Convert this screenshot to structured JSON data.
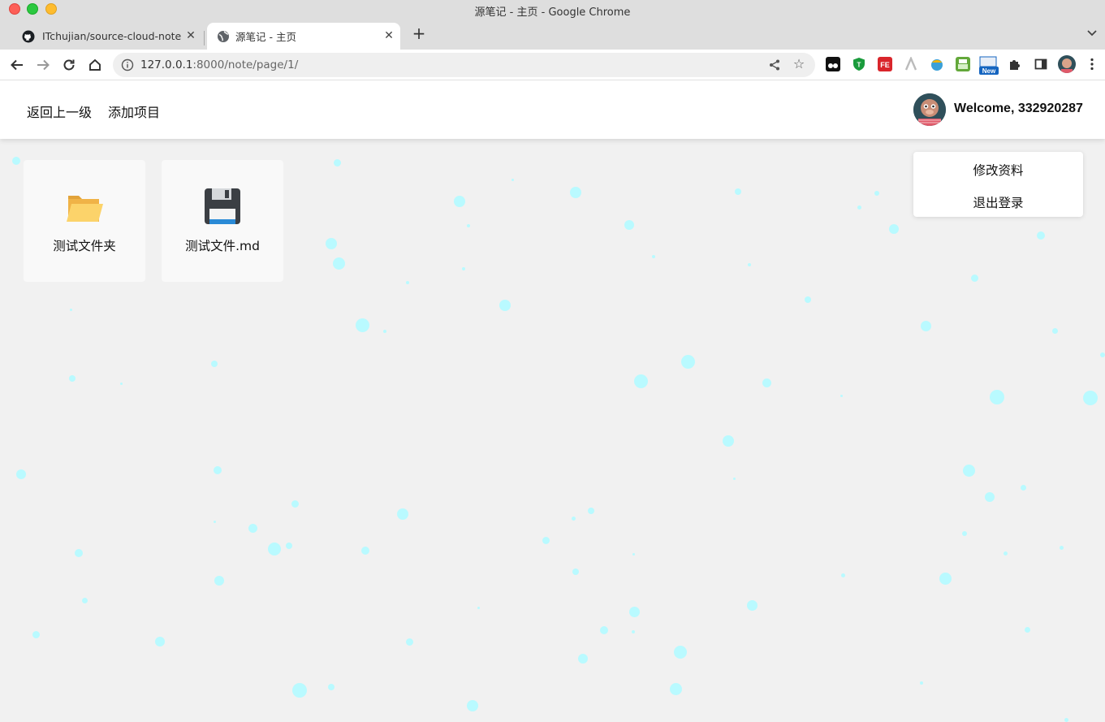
{
  "window": {
    "title": "源笔记 - 主页 - Google Chrome"
  },
  "tabs": [
    {
      "label": "ITchujian/source-cloud-note",
      "icon": "github-icon"
    },
    {
      "label": "源笔记 - 主页",
      "icon": "globe-icon",
      "active": true
    }
  ],
  "toolbar": {
    "url_host": "127.0.0.1",
    "url_rest": ":8000/note/page/1/",
    "extensions_badge": "New"
  },
  "navbar": {
    "back_label": "返回上一级",
    "add_label": "添加项目",
    "welcome_text": "Welcome, 332920287"
  },
  "user_menu": {
    "items": [
      "修改资料",
      "退出登录"
    ]
  },
  "items": [
    {
      "name": "测试文件夹",
      "type": "folder",
      "icon": "open-folder-icon"
    },
    {
      "name": "测试文件.md",
      "type": "file",
      "icon": "floppy-disk-icon"
    }
  ],
  "colors": {
    "particle": "#b9faff",
    "page_bg": "#f1f1f1",
    "card_bg": "#f9f9f9"
  }
}
